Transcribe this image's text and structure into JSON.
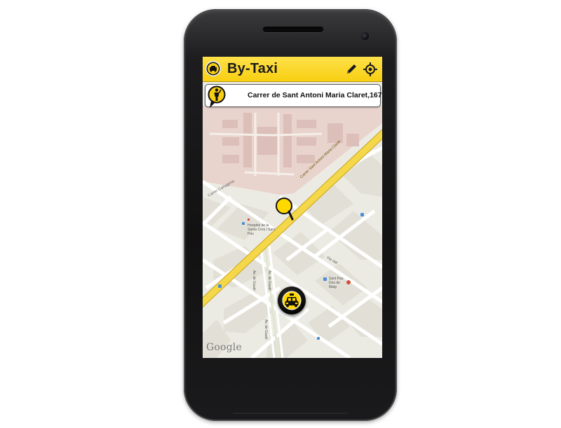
{
  "app": {
    "title": "By-Taxi"
  },
  "address": {
    "text": "Carrer de Sant Antoni Maria Claret,167"
  },
  "map": {
    "labels": {
      "claret_road": "Carrer Sant Antoni Maria Claret",
      "cartagena": "Carrer Cartagena",
      "hospital": "Hospital de la Santa Creu i Sant Pau",
      "av_gaudi_1": "Av. de Gaudí",
      "av_gaudi_2": "Av. de Gaudí",
      "av_gaudi_3": "Av. de Gaudí",
      "pla_vall": "Pla Vall",
      "metro": "Sant Pau Dos de Maig"
    },
    "attribution": "Google"
  },
  "colors": {
    "accent": "#f8cf12",
    "main_road": "#f5d84a",
    "hospital_area": "#e8d2cc",
    "map_bg": "#ecebe3"
  },
  "icons": {
    "app": "taxi-icon",
    "edit": "pencil-icon",
    "locate": "crosshair-icon",
    "address": "person-pin-icon",
    "map_pin": "location-pin-icon",
    "taxi_button": "taxi-icon"
  }
}
